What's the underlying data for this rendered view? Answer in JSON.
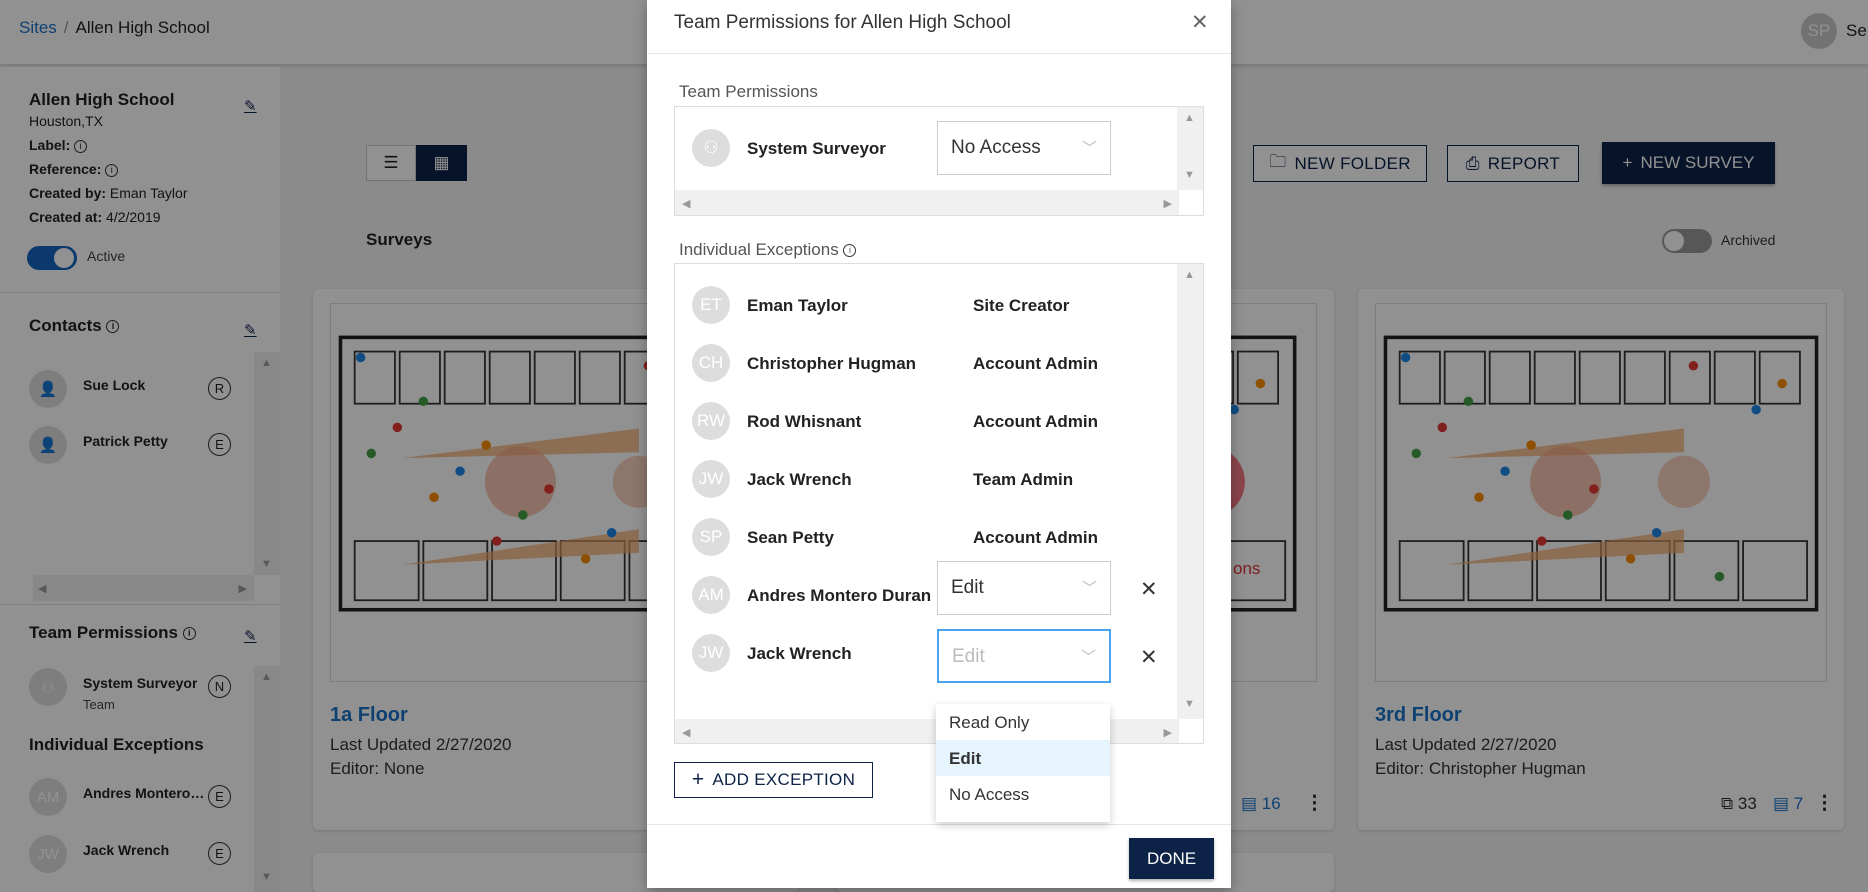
{
  "breadcrumb": {
    "root": "Sites",
    "current": "Allen High School"
  },
  "user": {
    "initials": "SP",
    "name_partial": "Se"
  },
  "site": {
    "name": "Allen High School",
    "location": "Houston,TX",
    "label_key": "Label:",
    "reference_key": "Reference:",
    "created_by_key": "Created by:",
    "created_by": "Eman Taylor",
    "created_at_key": "Created at:",
    "created_at": "4/2/2019",
    "active_label": "Active",
    "active": true
  },
  "contacts": {
    "title": "Contacts",
    "items": [
      {
        "name": "Sue Lock",
        "role": "R"
      },
      {
        "name": "Patrick Petty",
        "role": "E"
      }
    ]
  },
  "side_team": {
    "title": "Team Permissions",
    "team_name": "System Surveyor",
    "team_sub": "Team",
    "team_role": "N",
    "exceptions_title": "Individual Exceptions",
    "exceptions": [
      {
        "initials": "AM",
        "name": "Andres Montero Duran",
        "role": "E"
      },
      {
        "initials": "JW",
        "name": "Jack Wrench",
        "role": "E"
      }
    ]
  },
  "toolbar": {
    "new_folder": "NEW FOLDER",
    "report": "REPORT",
    "new_survey": "NEW SURVEY",
    "surveys_label": "Surveys",
    "archived_label": "Archived",
    "archived": false,
    "view": "grid"
  },
  "cards": [
    {
      "title": "1a Floor",
      "updated": "Last Updated 2/27/2020",
      "editor": "Editor: None"
    },
    {
      "title": "",
      "updated": "",
      "editor": "",
      "comments": "16"
    },
    {
      "title": "3rd Floor",
      "updated": "Last Updated 2/27/2020",
      "editor": "Editor: Christopher Hugman",
      "copies": "33",
      "comments": "7"
    }
  ],
  "plan_partial_text": "ons",
  "modal": {
    "title": "Team Permissions for Allen High School",
    "team_section": "Team Permissions",
    "team": {
      "name": "System Surveyor",
      "permission": "No Access"
    },
    "exceptions_section": "Individual Exceptions",
    "exceptions": [
      {
        "initials": "ET",
        "name": "Eman Taylor",
        "role": "Site Creator"
      },
      {
        "initials": "CH",
        "name": "Christopher Hugman",
        "role": "Account Admin"
      },
      {
        "initials": "RW",
        "name": "Rod Whisnant",
        "role": "Account Admin"
      },
      {
        "initials": "JW",
        "name": "Jack Wrench",
        "role": "Team Admin"
      },
      {
        "initials": "SP",
        "name": "Sean Petty",
        "role": "Account Admin"
      },
      {
        "initials": "AM",
        "name": "Andres Montero Duran",
        "permission": "Edit"
      },
      {
        "initials": "JW",
        "name": "Jack Wrench",
        "permission": "Edit"
      }
    ],
    "dropdown_options": [
      "Read Only",
      "Edit",
      "No Access"
    ],
    "dropdown_selected": "Edit",
    "add_exception": "ADD EXCEPTION",
    "done": "DONE"
  },
  "colors": {
    "primary": "#0d2247",
    "link": "#1a73c8",
    "focus": "#4aa3f0",
    "highlight": "#e6f4fd"
  }
}
